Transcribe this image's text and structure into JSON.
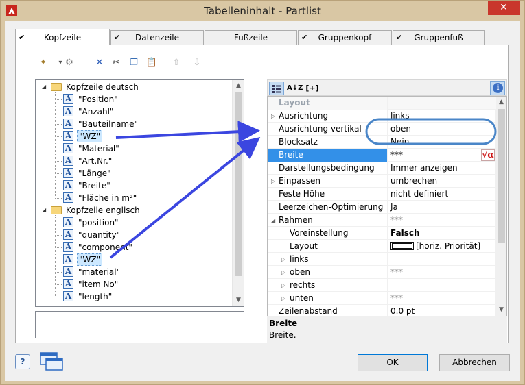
{
  "window": {
    "title": "Tabelleninhalt - Partlist",
    "close_glyph": "✕",
    "icon": "app-logo-icon"
  },
  "tabs": [
    {
      "label": "Kopfzeile",
      "checked": true,
      "active": true
    },
    {
      "label": "Datenzeile",
      "checked": true,
      "active": false
    },
    {
      "label": "Fußzeile",
      "checked": false,
      "active": false
    },
    {
      "label": "Gruppenkopf",
      "checked": true,
      "active": false
    },
    {
      "label": "Gruppenfuß",
      "checked": true,
      "active": false
    }
  ],
  "tree_toolbar": [
    {
      "name": "new-item-icon",
      "glyph": "✦"
    },
    {
      "name": "paste-dropdown-icon",
      "glyph": "▾"
    },
    {
      "name": "properties-icon",
      "glyph": "⚙"
    },
    {
      "name": "delete-icon",
      "glyph": "✕"
    },
    {
      "name": "cut-icon",
      "glyph": "✂"
    },
    {
      "name": "copy-icon",
      "glyph": "❐"
    },
    {
      "name": "paste-icon",
      "glyph": "📋"
    },
    {
      "name": "move-up-icon",
      "glyph": "⇧"
    },
    {
      "name": "move-down-icon",
      "glyph": "⇩"
    }
  ],
  "tree": {
    "groups": [
      {
        "label": "Kopfzeile deutsch",
        "items": [
          "\"Position\"",
          "\"Anzahl\"",
          "\"Bauteilname\"",
          "\"WZ\"",
          "\"Material\"",
          "\"Art.Nr.\"",
          "\"Länge\"",
          "\"Breite\"",
          "\"Fläche in m²\""
        ],
        "selected_index": 3
      },
      {
        "label": "Kopfzeile englisch",
        "items": [
          "\"position\"",
          "\"quantity\"",
          "\"component\"",
          "\"WZ\"",
          "\"material\"",
          "\"item No\"",
          "\"length\""
        ],
        "selected_index": 3
      }
    ]
  },
  "props_toolbar": {
    "categorized": "categorized-view-icon",
    "sort_az": "A↓Z",
    "expand": "[+]",
    "info": "i"
  },
  "properties": [
    {
      "kind": "category",
      "name": "Layout",
      "value": ""
    },
    {
      "kind": "row",
      "name": "Ausrichtung",
      "value": "links",
      "expander": true
    },
    {
      "kind": "row",
      "name": "Ausrichtung vertikal",
      "value": "oben"
    },
    {
      "kind": "row",
      "name": "Blocksatz",
      "value": "Nein"
    },
    {
      "kind": "selected",
      "name": "Breite",
      "value": "***",
      "formula": "√α"
    },
    {
      "kind": "row",
      "name": "Darstellungsbedingung",
      "value": "Immer anzeigen"
    },
    {
      "kind": "row",
      "name": "Einpassen",
      "value": "umbrechen",
      "expander": true
    },
    {
      "kind": "row",
      "name": "Feste Höhe",
      "value": "nicht definiert"
    },
    {
      "kind": "row",
      "name": "Leerzeichen-Optimierung",
      "value": "Ja"
    },
    {
      "kind": "row",
      "name": "Rahmen",
      "value": "***",
      "muted": true,
      "expander": true,
      "expanded": true
    },
    {
      "kind": "sub",
      "name": "Voreinstellung",
      "value": "Falsch",
      "bold": true
    },
    {
      "kind": "sub",
      "name": "Layout",
      "value": "[horiz. Priorität]",
      "swatch": true
    },
    {
      "kind": "sub2",
      "name": "links",
      "value": ""
    },
    {
      "kind": "sub2",
      "name": "oben",
      "value": "***",
      "muted": true
    },
    {
      "kind": "sub2",
      "name": "rechts",
      "value": ""
    },
    {
      "kind": "sub2",
      "name": "unten",
      "value": "***",
      "muted": true
    },
    {
      "kind": "row",
      "name": "Zeilenabstand",
      "value": "0.0 pt"
    }
  ],
  "description": {
    "title": "Breite",
    "text": "Breite."
  },
  "buttons": {
    "ok": "OK",
    "cancel": "Abbrechen",
    "help": "?"
  },
  "colors": {
    "selection": "#3390e8",
    "annotation_arrow": "#3b46e0",
    "annotation_circle": "#4a86c8"
  }
}
